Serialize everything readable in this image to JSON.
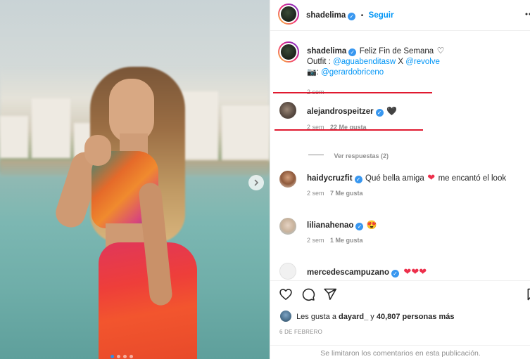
{
  "post": {
    "author": "shadelima",
    "follow_label": "Seguir",
    "dot_separator": "•",
    "caption": {
      "text": "Feliz Fin de Semana",
      "outfit_prefix": "Outfit :",
      "outfit_brand_1": "@aguabenditasw",
      "outfit_sep": "X",
      "outfit_brand_2": "@revolve",
      "camera_emoji": "📷",
      "photo_sep": ":",
      "photographer": "@gerardobriceno",
      "time": "2 sem"
    },
    "carousel": {
      "slide_count": 4,
      "active_index": 0
    }
  },
  "comments": [
    {
      "user": "alejandrospeitzer",
      "verified": true,
      "text": "🖤",
      "time": "2 sem",
      "likes": "22 Me gusta",
      "replies_label": "Ver respuestas (2)"
    },
    {
      "user": "haidycruzfit",
      "verified": true,
      "text_before": "Qué bella amiga",
      "heart": "❤",
      "text_after": "me encantó el look",
      "time": "2 sem",
      "likes": "7 Me gusta"
    },
    {
      "user": "lilianahenao",
      "verified": true,
      "text": "😍",
      "time": "2 sem",
      "likes": "1 Me gusta"
    },
    {
      "user": "mercedescampuzano",
      "verified": true,
      "text": "❤❤❤"
    }
  ],
  "likes_summary": {
    "prefix": "Les gusta a",
    "user": "dayard_",
    "middle": "y",
    "count": "40,807 personas más"
  },
  "date": "6 DE FEBRERO",
  "comments_limited": "Se limitaron los comentarios en esta publicación.",
  "icons": [
    "verified-badge-icon",
    "like-heart-icon",
    "comment-icon",
    "share-icon",
    "save-icon",
    "more-options-icon",
    "next-slide-icon"
  ],
  "colors": {
    "accent": "#0095f6",
    "underline": "#e0192f",
    "heart": "#ed2f4b"
  }
}
